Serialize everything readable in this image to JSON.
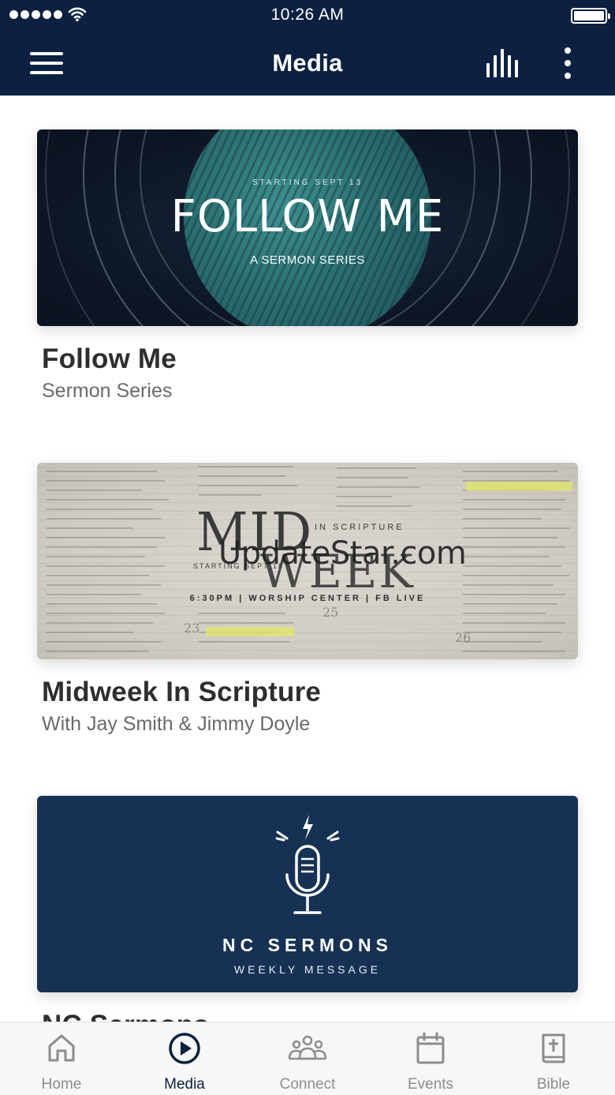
{
  "status_bar": {
    "time": "10:26 AM"
  },
  "header": {
    "title": "Media",
    "menu_icon": "hamburger-menu-icon",
    "stats_icon": "bar-chart-icon",
    "more_icon": "more-vertical-icon",
    "background_color": "#0c2041"
  },
  "media_items": [
    {
      "title": "Follow Me",
      "subtitle": "Sermon Series",
      "banner": {
        "pretitle": "STARTING SEPT 13",
        "headline": "FOLLOW ME",
        "tagline": "A SERMON SERIES"
      }
    },
    {
      "title": "Midweek In Scripture",
      "subtitle": "With Jay Smith & Jimmy Doyle",
      "banner": {
        "headline_top": "MID",
        "headline_bottom": "WEEK",
        "label": "IN SCRIPTURE",
        "pretitle": "STARTING SEPT 16",
        "details": "6:30PM | WORSHIP CENTER | FB LIVE",
        "verse_numbers": [
          "23",
          "25",
          "26"
        ],
        "watermark": "UpdateStar.com"
      }
    },
    {
      "title": "NC Sermons",
      "banner": {
        "headline": "NC SERMONS",
        "tagline": "WEEKLY MESSAGE",
        "icon": "microphone-icon",
        "background_color": "#163153"
      }
    }
  ],
  "tabs": [
    {
      "label": "Home",
      "icon": "home-icon",
      "active": false
    },
    {
      "label": "Media",
      "icon": "play-circle-icon",
      "active": true
    },
    {
      "label": "Connect",
      "icon": "people-group-icon",
      "active": false
    },
    {
      "label": "Events",
      "icon": "calendar-icon",
      "active": false
    },
    {
      "label": "Bible",
      "icon": "bible-icon",
      "active": false
    }
  ],
  "colors": {
    "active_tab": "#0c2041",
    "inactive_tab": "#8c8c8c"
  }
}
